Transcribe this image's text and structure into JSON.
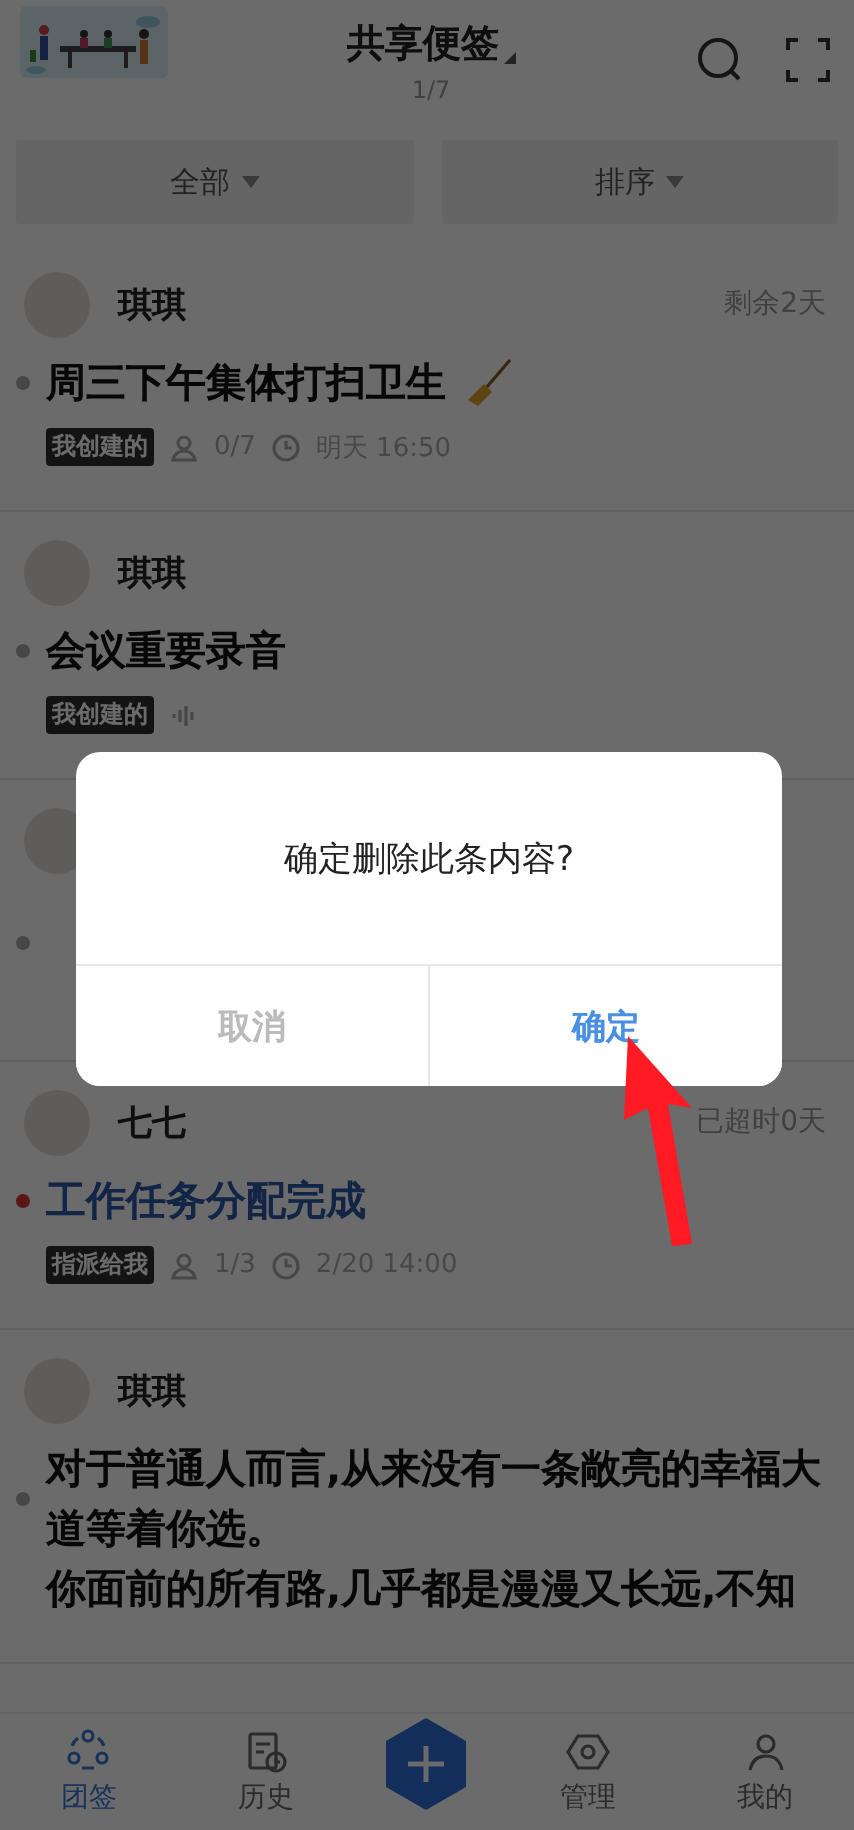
{
  "header": {
    "title": "共享便签",
    "page": "1/7"
  },
  "filters": [
    {
      "label": "全部"
    },
    {
      "label": "排序"
    }
  ],
  "cards": [
    {
      "kind": "task",
      "name": "琪琪",
      "due": "剩余2天",
      "overdue": false,
      "title_icon": true,
      "lines": [
        "周三下午集体打扫卫生"
      ],
      "tag": "我创建的",
      "members": "0/7",
      "time": "明天 16:50"
    },
    {
      "kind": "voice",
      "name": "琪琪",
      "overdue": false,
      "lines": [
        "会议重要录音"
      ],
      "tag": "我创建的"
    },
    {
      "kind": "covered"
    },
    {
      "kind": "task",
      "name": "七七",
      "due": "已超时0天",
      "overdue": true,
      "lines": [
        "工作任务分配完成"
      ],
      "tag": "指派给我",
      "members": "1/3",
      "time": "2/20 14:00"
    },
    {
      "kind": "note",
      "name": "琪琪",
      "overdue": false,
      "lines": [
        "对于普通人而言,从来没有一条敞亮的幸福大道等着你选。",
        "你面前的所有路,几乎都是漫漫又长远,不知"
      ]
    }
  ],
  "tabs": [
    {
      "kind": "tab",
      "label": "团签",
      "selected": true
    },
    {
      "kind": "tab",
      "label": "历史",
      "selected": false
    },
    {
      "kind": "add"
    },
    {
      "kind": "tab",
      "label": "管理",
      "selected": false
    },
    {
      "kind": "tab",
      "label": "我的",
      "selected": false
    }
  ],
  "dialog": {
    "message": "确定删除此条内容?",
    "buttons": [
      {
        "label": "取消",
        "kind": "cancel"
      },
      {
        "label": "确定",
        "kind": "confirm"
      }
    ]
  }
}
